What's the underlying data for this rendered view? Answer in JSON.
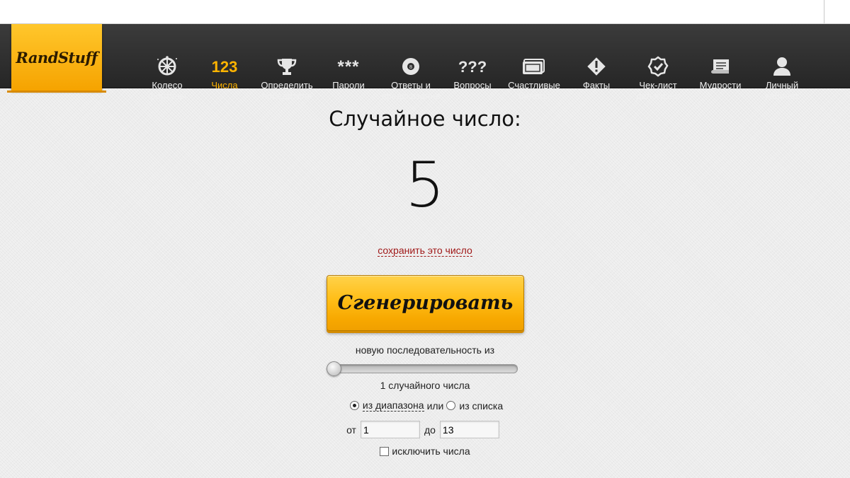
{
  "logo": {
    "text": "RandStuff"
  },
  "nav": {
    "items": [
      {
        "label": "Колесо\nфортуны",
        "icon": "wheel-of-fortune-icon"
      },
      {
        "label": "Числа",
        "icon": "123",
        "active": true
      },
      {
        "label": "Определить\nпобедителя",
        "icon": "trophy-icon"
      },
      {
        "label": "Пароли",
        "icon": "***"
      },
      {
        "label": "Ответы и\nпредсказания",
        "icon": "magic-ball-icon"
      },
      {
        "label": "Вопросы",
        "icon": "???"
      },
      {
        "label": "Счастливые\nбилеты",
        "icon": "tickets-icon"
      },
      {
        "label": "Факты",
        "icon": "warning-diamond-icon"
      },
      {
        "label": "Чек-лист\nдел жизни",
        "icon": "checklist-badge-icon"
      },
      {
        "label": "Мудрости",
        "icon": "scroll-icon"
      },
      {
        "label": "Личный\nкабинет",
        "icon": "user-icon"
      }
    ],
    "active_color": "#ffb400"
  },
  "main": {
    "title": "Случайное число:",
    "result": "5",
    "save_link": "сохранить это число",
    "generate_label": "Сгенерировать",
    "sequence_label": "новую последовательность из",
    "slider_value": 1,
    "count_label": "1 случайного числа",
    "mode": {
      "range_label": "из диапазона",
      "or_label": "или",
      "list_label": "из списка",
      "selected": "range"
    },
    "range": {
      "from_label": "от",
      "from_value": "1",
      "to_label": "до",
      "to_value": "13"
    },
    "exclude_label": "исключить числа",
    "accent": "#ffb400"
  }
}
